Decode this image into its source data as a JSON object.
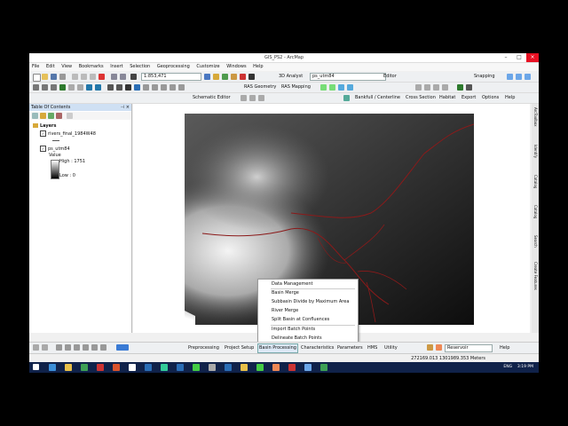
{
  "window": {
    "title": "GIS_PS2 - ArcMap"
  },
  "menubar": [
    "File",
    "Edit",
    "View",
    "Bookmarks",
    "Insert",
    "Selection",
    "Geoprocessing",
    "Customize",
    "Windows",
    "Help"
  ],
  "toolbar1": {
    "scale": "1:853,471",
    "analyst3d": "3D Analyst",
    "layer": "ps_utm84",
    "editor": "Editor",
    "snapping": "Snapping"
  },
  "toolbar2": {
    "ras_geometry": "RAS Geometry",
    "ras_mapping": "RAS Mapping"
  },
  "toolbar3": {
    "schematic_editor": "Schematic Editor",
    "bankfull": "Bankfull / Centerline",
    "cross_section": "Cross Section",
    "habitat": "Habitat",
    "export": "Export",
    "options": "Options",
    "help": "Help"
  },
  "toc": {
    "title": "Table Of Contents",
    "group": "Layers",
    "layer1": "rivers_final_1984W48",
    "layer2": "ps_utm84",
    "value_label": "Value",
    "high": "High : 1751",
    "low": "Low : 0"
  },
  "right_tabs": [
    "ArcToolbox",
    "Identify",
    "Catalog",
    "Catalog",
    "Search",
    "Create Features"
  ],
  "context_menu": {
    "items": [
      "Data Management",
      "Basin Merge",
      "Subbasin Divide by Maximum Area",
      "River Merge",
      "Split Basin at Confluences",
      "Import Batch Points",
      "Delineate Batch Points"
    ]
  },
  "bottom_toolbar": {
    "items": [
      "Preprocessing",
      "Project Setup",
      "Basin Processing",
      "Characteristics",
      "Parameters",
      "HMS",
      "Utility"
    ],
    "reservoir": "Reservoir",
    "help": "Help"
  },
  "status": {
    "coords": "272169.013  1301989.353 Meters"
  },
  "taskbar": {
    "lang": "ENG",
    "time": "3:19 PM"
  },
  "colors": {
    "highlight": "#cfe0f3",
    "river": "#8b1a1a",
    "taskbar": "#10224a"
  }
}
